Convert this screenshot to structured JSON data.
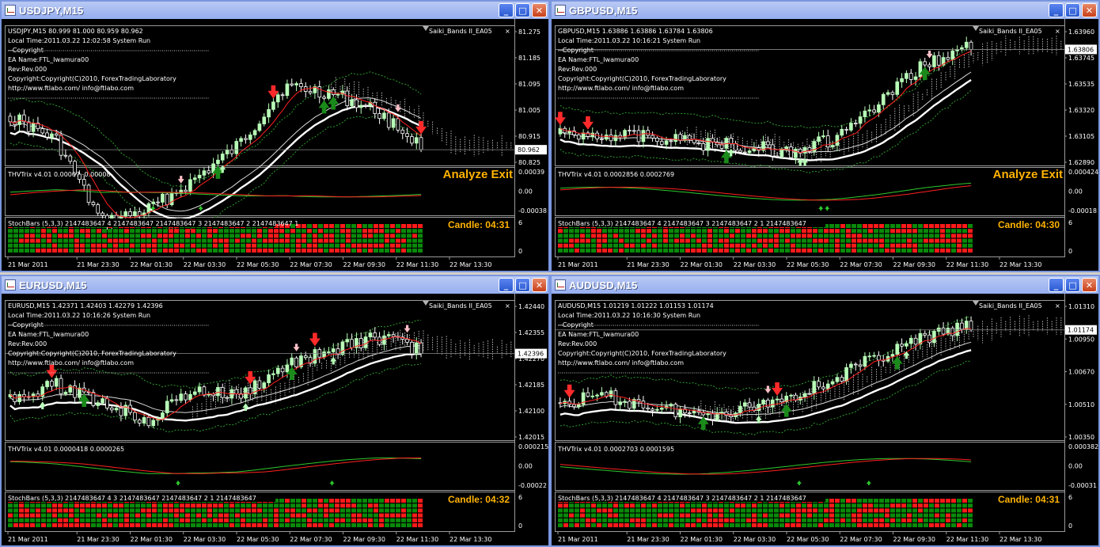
{
  "windows": [
    {
      "title": "USDJPY,M15",
      "info_lines": [
        "USDJPY,M15  80.999 81.000 80.959 80.962",
        "Local Time:2011.03.22 12:02:58 System Run",
        "--Copyright",
        "EA Name:FTL_Iwamura00",
        "Rev:Rev.000",
        "Copyright:Copyright(C)2010, ForexTradingLaboratory",
        "http://www.ftlabo.com/ info@ftlabo.com"
      ],
      "ea_label": "Saiki_Bands II_EA05",
      "price_ticks": [
        "81.275",
        "81.185",
        "81.095",
        "81.005",
        "80.915",
        "80.825"
      ],
      "current_price": "80.962",
      "trix_label": "THVTrix v4.01 0.00007 -0.00008",
      "trix_ticks": [
        "0.00039",
        "0.00",
        "-0.00038"
      ],
      "stoch_label": "StochBars (5,3,3) 2147483647 4 2147483647 2147483647 3 2147483647 2 2147483647 1",
      "stoch_ticks": [
        "6",
        "0"
      ],
      "analyze_label": "Analyze Exit",
      "candle_label": "Candle:  04:31",
      "time_labels": [
        "21 Mar 2011",
        "21 Mar 23:30",
        "22 Mar 01:30",
        "22 Mar 03:30",
        "22 Mar 05:30",
        "22 Mar 07:30",
        "22 Mar 09:30",
        "22 Mar 11:30",
        "22 Mar 13:30"
      ]
    },
    {
      "title": "GBPUSD,M15",
      "info_lines": [
        "GBPUSD,M15  1.63886 1.63886 1.63784 1.63806",
        "Local Time:2011.03.22 10:16:21 System Run",
        "--Copyright",
        "EA Name:FTL_Iwamura00",
        "Rev:Rev.000",
        "Copyright:Copyright(C)2010, ForexTradingLaboratory",
        "http://www.ftlabo.com/ info@ftlabo.com"
      ],
      "ea_label": "Saiki_Bands II_EA05",
      "price_ticks": [
        "1.63960",
        "1.63745",
        "1.63535",
        "1.63320",
        "1.63105",
        "1.62890"
      ],
      "current_price": "1.63806",
      "trix_label": "THVTrix v4.01 0.0002856 0.0002769",
      "trix_ticks": [
        "0.000424",
        "0.00",
        "-0.00018"
      ],
      "stoch_label": "StochBars (5,3,3) 2147483647 4 2147483647 3 2147483647 2 1 2147483647",
      "stoch_ticks": [
        "6",
        "0"
      ],
      "analyze_label": "Analyze Exit",
      "candle_label": "Candle:  04:30",
      "time_labels": [
        "21 Mar 2011",
        "21 Mar 23:30",
        "22 Mar 01:30",
        "22 Mar 03:30",
        "22 Mar 05:30",
        "22 Mar 07:30",
        "22 Mar 09:30",
        "22 Mar 11:30",
        "22 Mar 13:30"
      ]
    },
    {
      "title": "EURUSD,M15",
      "info_lines": [
        "EURUSD,M15  1.42371 1.42403 1.42279 1.42396",
        "Local Time:2011.03.22 10:16:26 System Run",
        "--Copyright",
        "EA Name:FTL_Iwamura00",
        "Rev:Rev.000",
        "Copyright:Copyright(C)2010, ForexTradingLaboratory",
        "http://www.ftlabo.com/ info@ftlabo.com"
      ],
      "ea_label": "Saiki_Bands II_EA05",
      "price_ticks": [
        "1.42440",
        "1.42355",
        "1.42270",
        "1.42185",
        "1.42100",
        "1.42015"
      ],
      "current_price": "1.42396",
      "trix_label": "THVTrix v4.01 0.0000418 0.0000265",
      "trix_ticks": [
        "0.000215",
        "0.00",
        "-0.00022"
      ],
      "stoch_label": "StochBars (5,3,3) 2147483647 4 3 2147483647 2147483647 2 1 2147483647",
      "stoch_ticks": [
        "6",
        "0"
      ],
      "analyze_label": "",
      "candle_label": "Candle:  04:32",
      "time_labels": [
        "21 Mar 2011",
        "21 Mar 23:30",
        "22 Mar 01:30",
        "22 Mar 03:30",
        "22 Mar 05:30",
        "22 Mar 07:30",
        "22 Mar 09:30",
        "22 Mar 11:30",
        "22 Mar 13:30"
      ]
    },
    {
      "title": "AUDUSD,M15",
      "info_lines": [
        "AUDUSD,M15  1.01219 1.01222 1.01153 1.01174",
        "Local Time:2011.03.22 10:16:30 System Run",
        "--Copyright",
        "EA Name:FTL_Iwamura00",
        "Rev:Rev.000",
        "Copyright:Copyright(C)2010, ForexTradingLaboratory",
        "http://www.ftlabo.com/ info@ftlabo.com"
      ],
      "ea_label": "Saiki_Bands II_EA05",
      "price_ticks": [
        "1.01310",
        "1.00950",
        "1.00670",
        "1.00510",
        "1.00350"
      ],
      "current_price": "1.01174",
      "trix_label": "THVTrix v4.01 0.0002703 0.0001595",
      "trix_ticks": [
        "0.000382",
        "0.00",
        "-0.00031"
      ],
      "stoch_label": "StochBars (5,3,3) 2147483647 4 2147483647 3 2147483647 2 1 2147483647",
      "stoch_ticks": [
        "6",
        "0"
      ],
      "analyze_label": "",
      "candle_label": "Candle:  04:31",
      "time_labels": [
        "21 Mar 2011",
        "21 Mar 23:30",
        "22 Mar 01:30",
        "22 Mar 03:30",
        "22 Mar 05:30",
        "22 Mar 07:30",
        "22 Mar 09:30",
        "22 Mar 11:30",
        "22 Mar 13:30"
      ]
    }
  ],
  "title_buttons": {
    "minimize": "_",
    "maximize": "□",
    "close": "✕"
  },
  "colors": {
    "bull": "#b8ffb8",
    "bear": "#ffffff",
    "up_arrow": "#1a8a1a",
    "down_arrow": "#ff2a2a",
    "stoch_red": "#ff1a1a",
    "stoch_green": "#0a8a0a",
    "label": "#ffb300"
  }
}
